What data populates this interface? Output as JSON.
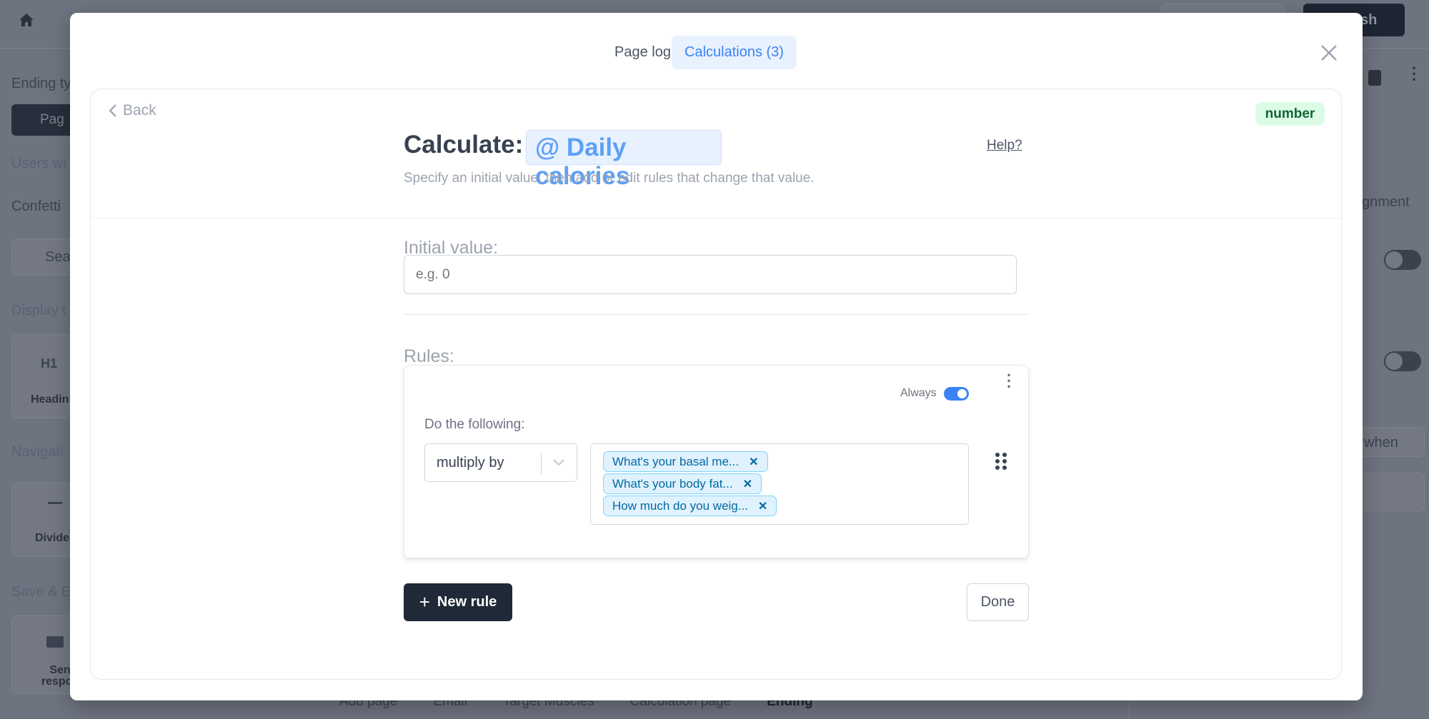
{
  "background": {
    "publish_label": "sh",
    "sidebar": {
      "ending_type": "Ending ty",
      "page_button": "Pag",
      "users_with": "Users wi",
      "confetti": "Confetti",
      "search_placeholder": "Sea",
      "display_text": "Display t",
      "heading_icon": "H1",
      "heading": "Headin",
      "navigation": "Navigati",
      "divider": "Divide",
      "save_exit": "Save & E",
      "send_response": "Send respons"
    },
    "right_panel": {
      "alignment": "gnment",
      "when": "when"
    },
    "bottom_tabs": [
      "Add page",
      "Email",
      "Target Muscles",
      "Calculation page",
      "Ending"
    ]
  },
  "modal": {
    "tabs": [
      {
        "label": "Page logic",
        "active": false
      },
      {
        "label": "Calculations (3)",
        "active": true
      }
    ],
    "back_label": "Back",
    "type_badge": "number",
    "title_prefix": "Calculate:",
    "variable": "@ Daily calories",
    "help_label": "Help?",
    "subtitle": "Specify an initial value, then add or edit rules that change that value.",
    "initial_value_label": "Initial value:",
    "initial_value": "",
    "initial_value_placeholder": "e.g. 0",
    "rules_label": "Rules:",
    "rules": [
      {
        "always_label": "Always",
        "always_on": true,
        "do_label": "Do the following:",
        "operation": "multiply by",
        "operands": [
          "What's your basal me...",
          "What's your body fat...",
          "How much do you weig..."
        ]
      }
    ],
    "new_rule_label": "New rule",
    "done_label": "Done"
  },
  "colors": {
    "accent": "#3b82f6",
    "dark": "#1f2937",
    "badge_bg": "#dcfce7",
    "badge_text": "#166534",
    "tag_bg": "#e0f2fe"
  }
}
